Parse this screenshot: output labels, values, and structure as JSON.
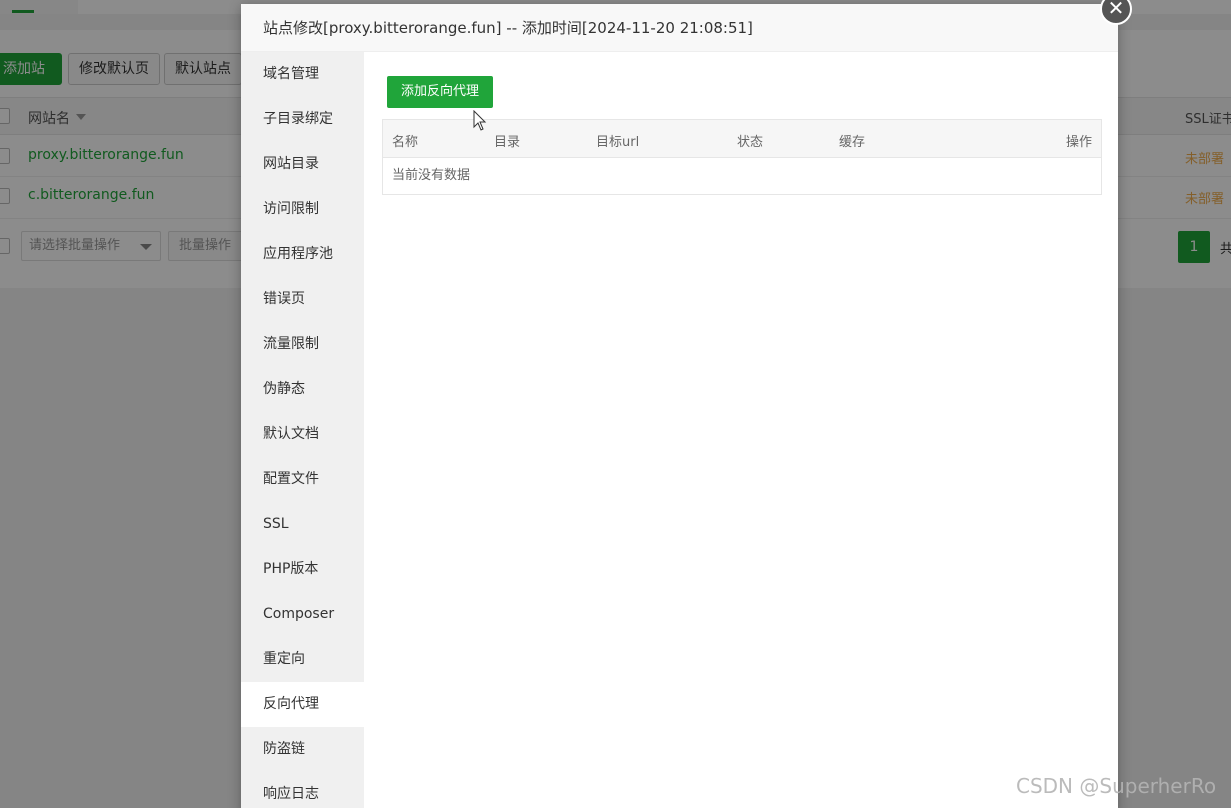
{
  "background": {
    "buttons": {
      "add_site": "添加站点",
      "edit_default_page": "修改默认页",
      "default_site": "默认站点"
    },
    "table": {
      "site_name_header": "网站名",
      "ssl_header": "SSL证书",
      "rows": [
        {
          "name": "proxy.bitterorange.fun",
          "ssl": "未部署"
        },
        {
          "name": "c.bitterorange.fun",
          "ssl": "未部署"
        }
      ]
    },
    "batch_select_placeholder": "请选择批量操作",
    "batch_button": "批量操作",
    "pagination": {
      "current": "1",
      "total_prefix": "共"
    }
  },
  "modal": {
    "title": "站点修改[proxy.bitterorange.fun] -- 添加时间[2024-11-20 21:08:51]",
    "close_icon": "close-icon",
    "nav": [
      {
        "label": "域名管理",
        "active": false
      },
      {
        "label": "子目录绑定",
        "active": false
      },
      {
        "label": "网站目录",
        "active": false
      },
      {
        "label": "访问限制",
        "active": false
      },
      {
        "label": "应用程序池",
        "active": false
      },
      {
        "label": "错误页",
        "active": false
      },
      {
        "label": "流量限制",
        "active": false
      },
      {
        "label": "伪静态",
        "active": false
      },
      {
        "label": "默认文档",
        "active": false
      },
      {
        "label": "配置文件",
        "active": false
      },
      {
        "label": "SSL",
        "active": false
      },
      {
        "label": "PHP版本",
        "active": false
      },
      {
        "label": "Composer",
        "active": false
      },
      {
        "label": "重定向",
        "active": false
      },
      {
        "label": "反向代理",
        "active": true
      },
      {
        "label": "防盗链",
        "active": false
      },
      {
        "label": "响应日志",
        "active": false
      }
    ],
    "add_proxy_button": "添加反向代理",
    "table": {
      "columns": [
        "名称",
        "目录",
        "目标url",
        "状态",
        "缓存",
        "操作"
      ],
      "empty_text": "当前没有数据"
    }
  },
  "watermark": "CSDN @SuperherRo",
  "colors": {
    "accent": "#20a53a",
    "warning": "#f0ad4e"
  }
}
